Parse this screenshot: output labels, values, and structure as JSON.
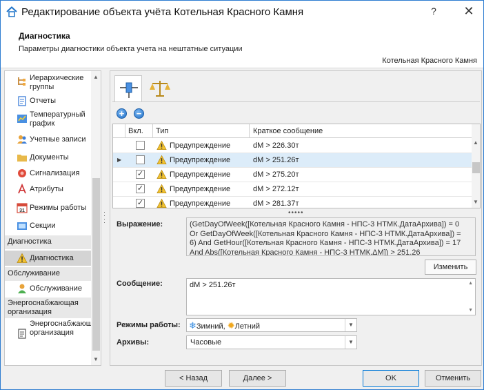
{
  "window": {
    "title": "Редактирование объекта учёта Котельная Красного Камня",
    "help_label": "?",
    "close_label": "✕"
  },
  "header": {
    "title": "Диагностика",
    "subtitle": "Параметры диагностики объекта учета на нештатные ситуации",
    "object_name": "Котельная Красного Камня"
  },
  "sidebar": {
    "items": [
      {
        "label": "Иерархические группы",
        "icon": "hierarchy-icon"
      },
      {
        "label": "Отчеты",
        "icon": "report-icon"
      },
      {
        "label": "Температурный график",
        "icon": "temperature-chart-icon"
      },
      {
        "label": "Учетные записи",
        "icon": "users-icon"
      },
      {
        "label": "Документы",
        "icon": "folder-icon"
      },
      {
        "label": "Сигнализация",
        "icon": "alarm-icon"
      },
      {
        "label": "Атрибуты",
        "icon": "attribute-icon"
      },
      {
        "label": "Режимы работы",
        "icon": "calendar-icon"
      },
      {
        "label": "Секции",
        "icon": "sections-icon"
      }
    ],
    "groups": [
      {
        "label": "Диагностика",
        "item": {
          "label": "Диагностика",
          "icon": "warning-icon",
          "selected": true
        }
      },
      {
        "label": "Обслуживание",
        "item": {
          "label": "Обслуживание",
          "icon": "person-icon"
        }
      },
      {
        "label": "Энергоснабжающая организация",
        "item": {
          "label": "Энергоснабжающая организация",
          "icon": "document-icon"
        }
      }
    ]
  },
  "tabs": [
    {
      "name": "diagnostics-tab",
      "icon": "sensor-icon",
      "active": true
    },
    {
      "name": "scales-tab",
      "icon": "scales-icon",
      "active": false
    }
  ],
  "grid": {
    "columns": [
      "Вкл.",
      "Тип",
      "Краткое сообщение"
    ],
    "rows": [
      {
        "enabled": false,
        "type": "Предупреждение",
        "message": "dM > 226.30т",
        "selected": false
      },
      {
        "enabled": false,
        "type": "Предупреждение",
        "message": "dM > 251.26т",
        "selected": true
      },
      {
        "enabled": true,
        "type": "Предупреждение",
        "message": "dM > 275.20т",
        "selected": false
      },
      {
        "enabled": true,
        "type": "Предупреждение",
        "message": "dM > 272.12т",
        "selected": false
      },
      {
        "enabled": true,
        "type": "Предупреждение",
        "message": "dM > 281.37т",
        "selected": false
      }
    ]
  },
  "form": {
    "expression_label": "Выражение:",
    "expression_value": "(GetDayOfWeek([Котельная Красного Камня - НПС-3 НТМК.ДатаАрхива]) = 0\nOr GetDayOfWeek([Котельная Красного Камня - НПС-3 НТМК.ДатаАрхива]) =\n6) And GetHour([Котельная Красного Камня - НПС-3 НТМК.ДатаАрхива]) = 17\nAnd Abs([Котельная Красного Камня - НПС-3 НТМК.ΔM]) > 251.26",
    "edit_label": "Изменить",
    "message_label": "Сообщение:",
    "message_value": "dM > 251.26т",
    "modes_label": "Режимы работы:",
    "modes_winter": "Зимний,",
    "modes_summer": "Летний",
    "archives_label": "Архивы:",
    "archives_value": "Часовые"
  },
  "footer": {
    "back_label": "< Назад",
    "next_label": "Далее >",
    "ok_label": "OK",
    "cancel_label": "Отменить"
  },
  "colors": {
    "accent": "#0078d7",
    "selected_row": "#dcecf9",
    "warning": "#f2c230"
  }
}
